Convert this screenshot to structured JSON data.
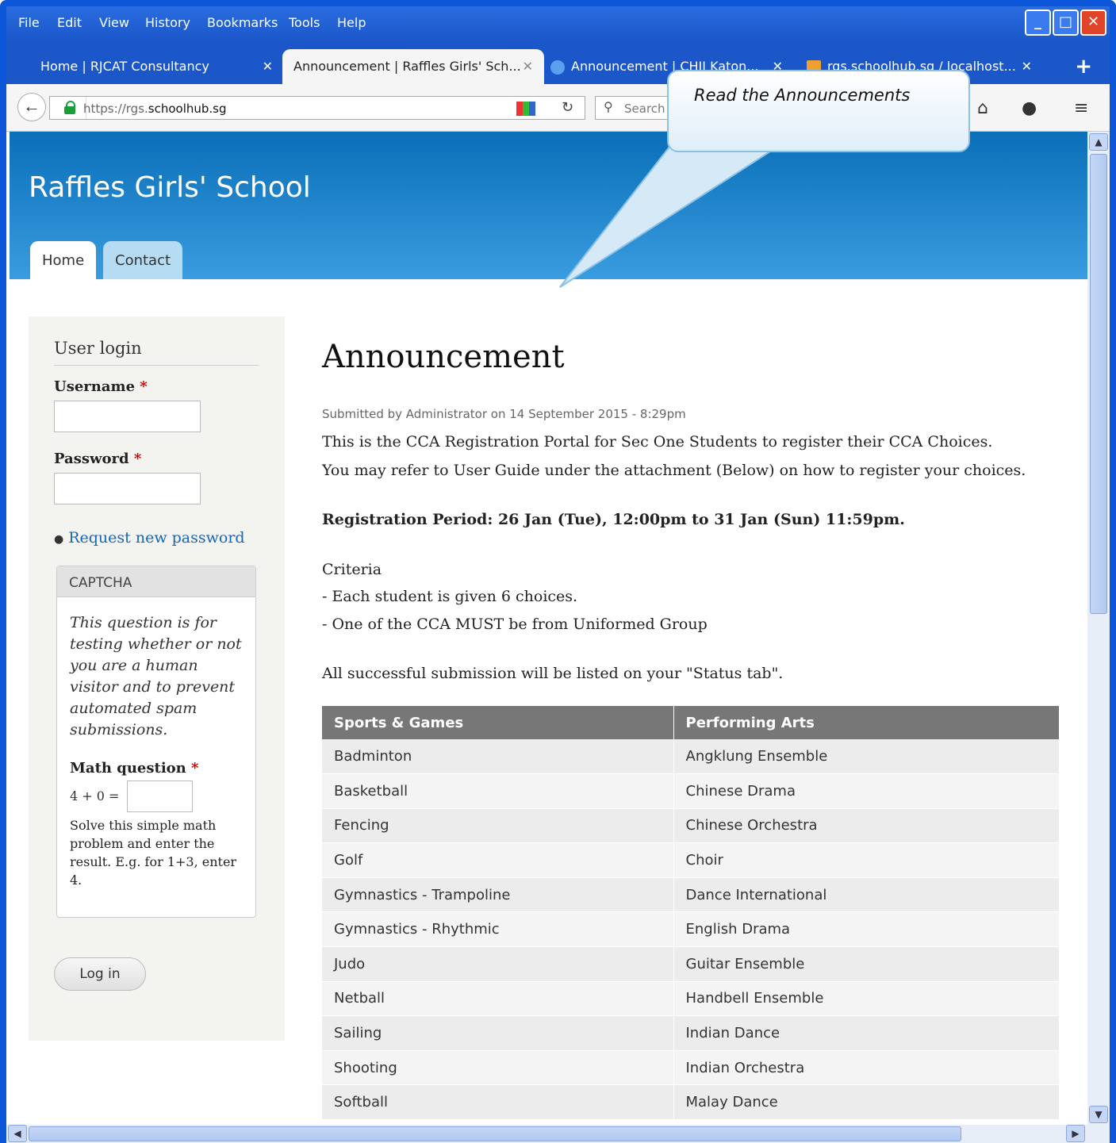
{
  "menu": [
    "File",
    "Edit",
    "View",
    "History",
    "Bookmarks",
    "Tools",
    "Help"
  ],
  "tabs": [
    {
      "label": "Home | RJCAT Consultancy"
    },
    {
      "label": "Announcement | Raffles Girls' Sch..."
    },
    {
      "label": "Announcement | CHIJ Katon..."
    },
    {
      "label": "rgs.schoolhub.sg / localhost..."
    }
  ],
  "url": {
    "scheme": "https://rgs.",
    "host": "schoolhub.sg"
  },
  "search": {
    "placeholder": "Search"
  },
  "callout": {
    "text": "Read the Announcements"
  },
  "site": {
    "name": "Raffles Girls' School"
  },
  "primary_tabs": [
    "Home",
    "Contact"
  ],
  "login": {
    "title": "User login",
    "username_label": "Username",
    "password_label": "Password",
    "required_mark": "*",
    "request_password": "Request new password",
    "captcha_title": "CAPTCHA",
    "captcha_description": "This question is for testing whether or not you are a human visitor and to prevent automated spam submissions.",
    "math_label": "Math question",
    "math_question": "4 + 0 =",
    "math_help": "Solve this simple math problem and enter the result. E.g. for 1+3, enter 4.",
    "login_button": "Log in"
  },
  "article": {
    "title": "Announcement",
    "submitted": "Submitted by Administrator on 14 September 2015 - 8:29pm",
    "intro1": "This is the CCA Registration Portal for Sec One Students to register their CCA Choices.",
    "intro2": "You may refer to User Guide under the attachment (Below) on how to register your choices.",
    "period": "Registration Period: 26 Jan (Tue), 12:00pm to 31 Jan (Sun) 11:59pm.",
    "criteria": "Criteria",
    "criteria1": "- Each student is given 6 choices.",
    "criteria2": "- One of the CCA MUST be from Uniformed Group",
    "status_note": "All successful submission will be listed on your \"Status tab\"."
  },
  "cca_table": {
    "headers": [
      "Sports & Games",
      "Performing Arts"
    ],
    "rows": [
      [
        "Badminton",
        "Angklung Ensemble"
      ],
      [
        "Basketball",
        "Chinese Drama"
      ],
      [
        "Fencing",
        "Chinese Orchestra"
      ],
      [
        "Golf",
        "Choir"
      ],
      [
        "Gymnastics - Trampoline",
        "Dance International"
      ],
      [
        "Gymnastics - Rhythmic",
        "English Drama"
      ],
      [
        "Judo",
        "Guitar Ensemble"
      ],
      [
        "Netball",
        "Handbell Ensemble"
      ],
      [
        "Sailing",
        "Indian Dance"
      ],
      [
        "Shooting",
        "Indian Orchestra"
      ],
      [
        "Softball",
        "Malay Dance"
      ]
    ]
  },
  "colors": {
    "header_blue": "#0a6fb8",
    "link": "#1565b8",
    "table_header": "#777777"
  }
}
